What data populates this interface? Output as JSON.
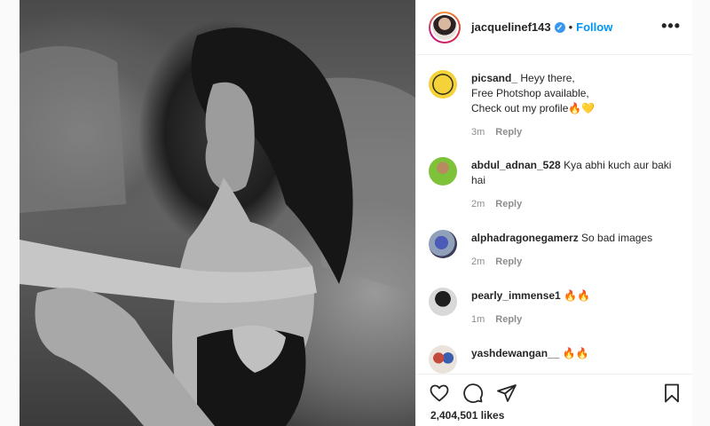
{
  "post": {
    "owner": {
      "username": "jacquelinef143",
      "verified": true,
      "dot": "•",
      "follow_label": "Follow",
      "more_label": "•••"
    },
    "comments": [
      {
        "username": "picsand_",
        "text": "Heyy there,\nFree Photshop available,\nCheck out my profile",
        "emoji": "🔥💛",
        "time": "3m",
        "reply_label": "Reply"
      },
      {
        "username": "abdul_adnan_528",
        "text": "Kya abhi kuch aur baki hai",
        "emoji": "",
        "time": "2m",
        "reply_label": "Reply"
      },
      {
        "username": "alphadragonegamerz",
        "text": "So bad images",
        "emoji": "",
        "time": "2m",
        "reply_label": "Reply"
      },
      {
        "username": "pearly_immense1",
        "text": "",
        "emoji": "🔥🔥",
        "time": "1m",
        "reply_label": "Reply"
      },
      {
        "username": "yashdewangan__",
        "text": "",
        "emoji": "🔥🔥",
        "time": "",
        "reply_label": ""
      }
    ],
    "likes_text": "2,404,501 likes"
  },
  "icons": [
    "heart-icon",
    "comment-icon",
    "share-icon",
    "bookmark-icon",
    "verified-badge-icon",
    "more-options-icon"
  ],
  "colors": {
    "link_blue": "#0095f6",
    "verified_blue": "#3897f0",
    "meta_gray": "#8e8e8e",
    "text": "#262626"
  }
}
